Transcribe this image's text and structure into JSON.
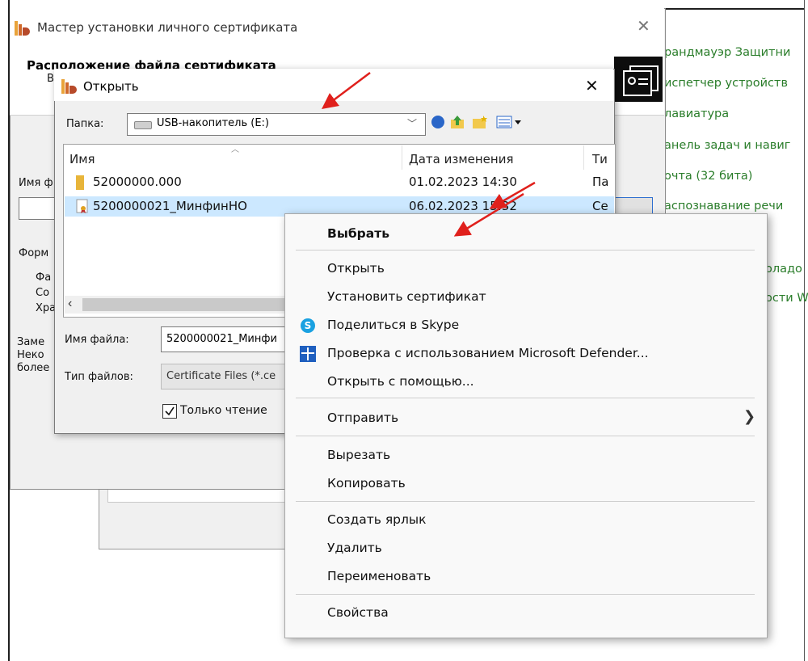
{
  "background_links": [
    "рандмауэр Защитни",
    "испетчер устройств",
    "лавиатура",
    "анель задач и навиг",
    "очта (32 бита)",
    "аспознавание речи",
    "оладо",
    "ости W"
  ],
  "wizard": {
    "title": "Мастер установки личного сертификата",
    "heading": "Расположение файла сертификата",
    "heading_fragment": "В",
    "filename_label": "Имя ф",
    "format_label": "Форм",
    "format_lines": [
      "Фа",
      "Со",
      "Хра"
    ],
    "note_lines": [
      "Заме",
      "Неко",
      "более"
    ],
    "close_glyph": "✕"
  },
  "open_dialog": {
    "title": "Открыть",
    "close_glyph": "✕",
    "folder_label": "Папка:",
    "folder_value": "USB-накопитель (E:)",
    "columns": {
      "name": "Имя",
      "date": "Дата изменения",
      "type": "Ти"
    },
    "files": [
      {
        "name": "52000000.000",
        "date": "01.02.2023 14:30",
        "type": "Па"
      },
      {
        "name": "5200000021_МинфинНО",
        "date": "06.02.2023 15:32",
        "type": "Се"
      }
    ],
    "filename_label": "Имя файла:",
    "filename_value": "5200000021_Минфи",
    "filetype_label": "Тип файлов:",
    "filetype_value": "Certificate Files (*.ce",
    "readonly_label": "Только чтение",
    "readonly_checked": true
  },
  "context_menu": {
    "items": [
      {
        "label": "Выбрать",
        "bold": true,
        "icon": ""
      },
      {
        "label": "Открыть",
        "icon": ""
      },
      {
        "label": "Установить сертификат",
        "icon": ""
      },
      {
        "label": "Поделиться в Skype",
        "icon": "skype-icon"
      },
      {
        "label": "Проверка с использованием Microsoft Defender...",
        "icon": "defender-shield-icon"
      },
      {
        "label": "Открыть с помощью...",
        "icon": ""
      },
      {
        "label": "Отправить",
        "icon": "",
        "submenu": true
      },
      {
        "label": "Вырезать",
        "icon": ""
      },
      {
        "label": "Копировать",
        "icon": ""
      },
      {
        "label": "Создать ярлык",
        "icon": ""
      },
      {
        "label": "Удалить",
        "icon": ""
      },
      {
        "label": "Переименовать",
        "icon": ""
      },
      {
        "label": "Свойства",
        "icon": ""
      }
    ],
    "submenu_glyph": "❯"
  },
  "colors": {
    "link_green": "#2a7d2a",
    "selection": "#cce8ff",
    "arrow_red": "#e0201c"
  }
}
